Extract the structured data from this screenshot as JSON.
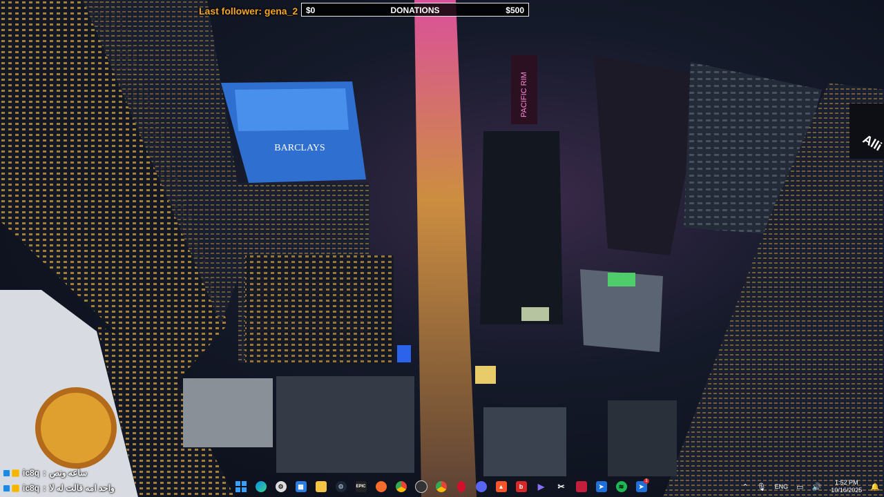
{
  "overlay": {
    "last_follower": "Last follower: gena_2",
    "donations": {
      "min": "$0",
      "title": "DONATIONS",
      "max": "$500"
    }
  },
  "scene": {
    "billboard_barclays": "BARCLAYS",
    "billboard_pacific_rim": "PACIFIC RIM",
    "billboard_allianz": "Alli"
  },
  "chat": [
    {
      "user": "ic8q",
      "message": "ساعه ونص"
    },
    {
      "user": "ic8q",
      "message": "واحد امه قالت له لا"
    }
  ],
  "taskbar": {
    "apps": [
      {
        "name": "start-icon"
      },
      {
        "name": "edge-icon"
      },
      {
        "name": "settings-icon"
      },
      {
        "name": "store-icon"
      },
      {
        "name": "file-explorer-icon"
      },
      {
        "name": "steam-icon"
      },
      {
        "name": "epic-games-icon",
        "label": "EPIC"
      },
      {
        "name": "origin-icon"
      },
      {
        "name": "chrome-icon"
      },
      {
        "name": "obs-icon"
      },
      {
        "name": "chrome-alt-icon"
      },
      {
        "name": "opera-icon"
      },
      {
        "name": "discord-icon"
      },
      {
        "name": "brave-icon"
      },
      {
        "name": "app-red-icon",
        "label": "b"
      },
      {
        "name": "media-player-icon"
      },
      {
        "name": "capcut-icon"
      },
      {
        "name": "app-red-square-icon"
      },
      {
        "name": "app-blue-arrow-icon"
      },
      {
        "name": "spotify-icon"
      },
      {
        "name": "app-blue-notify-icon",
        "badge": "1"
      }
    ],
    "tray": {
      "language": "ENG",
      "time": "1:52 PM",
      "date": "10/16/2025"
    }
  },
  "colors": {
    "follower_text": "#f5a623",
    "donation_bg": "#000000",
    "barclays_blue": "#3d8ce8"
  }
}
